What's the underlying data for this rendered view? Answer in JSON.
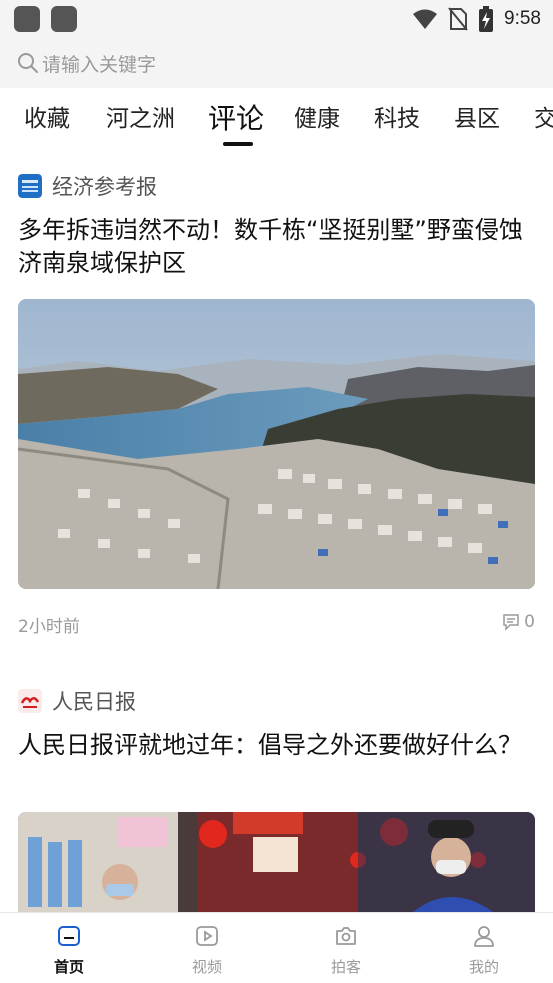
{
  "status_bar": {
    "time": "9:58",
    "icons": [
      "app-icon",
      "app-icon",
      "wifi-icon",
      "no-sim-icon",
      "battery-charging-icon"
    ]
  },
  "search": {
    "placeholder": "请输入关键字",
    "icon": "search-icon"
  },
  "tabs": [
    {
      "label": "收藏",
      "active": false
    },
    {
      "label": "河之洲",
      "active": false
    },
    {
      "label": "评论",
      "active": true
    },
    {
      "label": "健康",
      "active": false
    },
    {
      "label": "科技",
      "active": false
    },
    {
      "label": "县区",
      "active": false
    },
    {
      "label": "交",
      "active": false
    }
  ],
  "articles": [
    {
      "source": "经济参考报",
      "source_logo": "jingji-cankaobao-logo",
      "title": "多年拆违岿然不动！数千栋“坚挺别墅”野蛮侵蚀济南泉域保护区",
      "image": "aerial-reservoir-villas-photo",
      "time": "2小时前",
      "comments": "0"
    },
    {
      "source": "人民日报",
      "source_logo": "renmin-ribao-logo",
      "title": "人民日报评就地过年：倡导之外还要做好什么？",
      "image": "supermarket-shoppers-photo"
    }
  ],
  "bottom_nav": [
    {
      "label": "首页",
      "icon": "home-icon",
      "active": true
    },
    {
      "label": "视频",
      "icon": "video-icon",
      "active": false
    },
    {
      "label": "拍客",
      "icon": "camera-icon",
      "active": false
    },
    {
      "label": "我的",
      "icon": "profile-icon",
      "active": false
    }
  ],
  "colors": {
    "accent": "#111111",
    "muted": "#9a9a9a",
    "background": "#f4f4f4"
  }
}
